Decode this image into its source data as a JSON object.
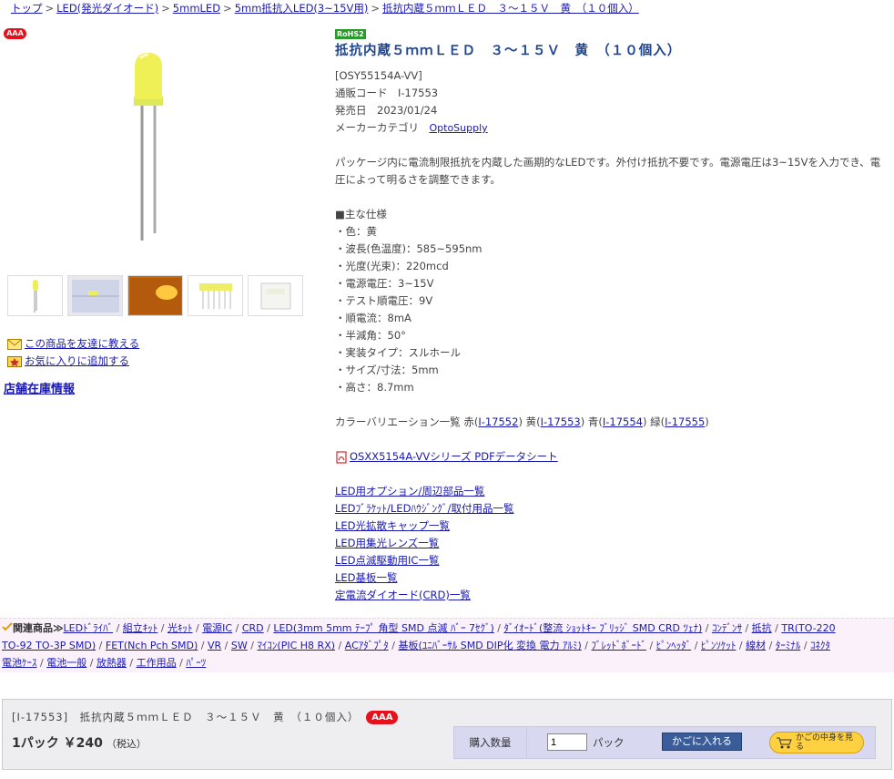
{
  "breadcrumb": {
    "items": [
      "トップ",
      "LED(発光ダイオード)",
      "5mmLED",
      "5mm抵抗入LED(3~15V用)",
      "抵抗内蔵５ｍｍＬＥＤ　３～１５Ｖ　黄　（１０個入）"
    ],
    "sep": ">"
  },
  "rank": "AAA",
  "rohs": "RoHS2",
  "product": {
    "title": "抵抗内蔵５ｍｍＬＥＤ　３～１５Ｖ　黄　（１０個入）",
    "model": "[OSY55154A-VV]",
    "code_label": "通販コード",
    "code": "I-17553",
    "date_label": "発売日",
    "date": "2023/01/24",
    "maker_label": "メーカーカテゴリ",
    "maker": "OptoSupply",
    "desc": "パッケージ内に電流制限抵抗を内蔵した画期的なLEDです。外付け抵抗不要です。電源電圧は3~15Vを入力でき、電圧によって明るさを調整できます。",
    "spec_title": "■主な仕様",
    "specs": [
      "・色：黄",
      "・波長(色温度)：585~595nm",
      "・光度(光束)：220mcd",
      "・電源電圧：3~15V",
      "・テスト順電圧：9V",
      "・順電流：8mA",
      "・半減角：50°",
      "・実装タイプ：スルホール",
      "・サイズ/寸法：5mm",
      "・高さ：8.7mm"
    ],
    "variation_label": "カラーバリエーション一覧",
    "variations": [
      {
        "color": "赤",
        "code": "I-17552"
      },
      {
        "color": "黄",
        "code": "I-17553"
      },
      {
        "color": "青",
        "code": "I-17554"
      },
      {
        "color": "緑",
        "code": "I-17555"
      }
    ],
    "pdf": "OSXX5154A-VVシリーズ PDFデータシート",
    "lists": [
      "LED用オプション/周辺部品一覧",
      "LEDﾌﾞﾗｹｯﾄ/LEDﾊｳｼﾞﾝｸﾞ/取付用品一覧",
      "LED光拡散キャップ一覧",
      "LED用集光レンズ一覧",
      "LED点滅駆動用IC一覧",
      "LED基板一覧",
      "定電流ダイオード(CRD)一覧"
    ]
  },
  "left": {
    "tell_friend": "この商品を友達に教える",
    "add_fav": "お気に入りに追加する",
    "store_stock": "店舗在庫情報"
  },
  "related": {
    "label": "関連商品≫",
    "line1": [
      "LEDﾄﾞﾗｲﾊﾞ",
      "組立ｷｯﾄ",
      "光ｷｯﾄ",
      "電源IC",
      "CRD",
      "LED(3mm 5mm ﾃｰﾌﾟ 角型 SMD 点滅 ﾊﾞｰ 7ｾｸﾞ)",
      "ﾀﾞｲｵｰﾄﾞ(整流 ｼｮｯﾄｷｰ ﾌﾞﾘｯｼﾞ SMD CRD ﾂｪﾅ)",
      "ｺﾝﾃﾞﾝｻ",
      "抵抗",
      "TR(TO-220"
    ],
    "line2": [
      "TO-92 TO-3P SMD)",
      "FET(Nch Pch SMD)",
      "VR",
      "SW",
      "ﾏｲｺﾝ(PIC H8 RX)",
      "ACｱﾀﾞﾌﾟﾀ",
      "基板(ﾕﾆﾊﾞｰｻﾙ SMD DIP化 変換 電力 ｱﾙﾐ)",
      "ﾌﾞﾚｯﾄﾞﾎﾞｰﾄﾞ",
      "ﾋﾟﾝﾍｯﾀﾞ",
      "ﾋﾟﾝｿｹｯﾄ",
      "線材",
      "ﾀｰﾐﾅﾙ",
      "ｺﾈｸﾀ"
    ],
    "line3": [
      "電池ｹｰｽ",
      "電池一般",
      "放熱器",
      "工作用品",
      "ﾊﾟｰﾂ"
    ]
  },
  "buy": {
    "name": "[I-17553]　抵抗内蔵５ｍｍＬＥＤ　３～１５Ｖ　黄　（１０個入）",
    "price": "1パック ￥240",
    "tax": "（税込）",
    "qty_label": "購入数量",
    "qty": "1",
    "unit": "パック",
    "cart": "かごに入れる",
    "view_cart": "かごの中身を見る"
  }
}
